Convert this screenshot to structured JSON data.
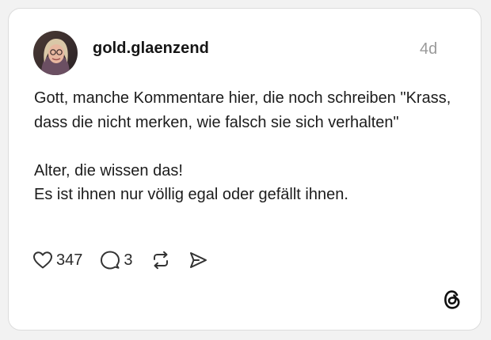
{
  "post": {
    "username": "gold.glaenzend",
    "timestamp": "4d",
    "paragraphs": [
      "Gott, manche Kommentare hier, die noch schreiben \"Krass, dass die nicht merken, wie falsch sie sich verhalten\"",
      "Alter, die wissen das!\nEs ist ihnen nur völlig egal oder gefällt ihnen."
    ]
  },
  "actions": {
    "like_count": "347",
    "reply_count": "3"
  },
  "icons": {
    "like": "heart-icon",
    "reply": "comment-bubble-icon",
    "repost": "repost-icon",
    "share": "send-icon",
    "logo": "threads-logo-icon"
  },
  "colors": {
    "background": "#f2f2f2",
    "card": "#ffffff",
    "text": "#1b1b1b",
    "muted": "#9a9a9a",
    "icon": "#333333"
  }
}
